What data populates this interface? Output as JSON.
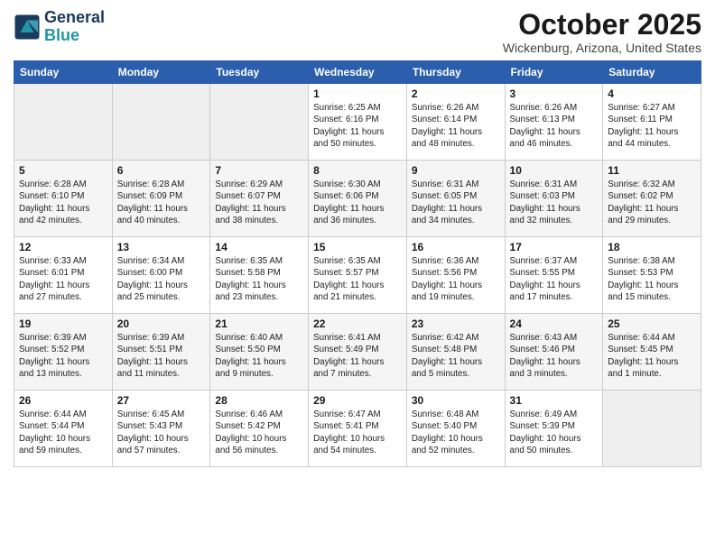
{
  "header": {
    "logo_line1": "General",
    "logo_line2": "Blue",
    "month": "October 2025",
    "location": "Wickenburg, Arizona, United States"
  },
  "days_of_week": [
    "Sunday",
    "Monday",
    "Tuesday",
    "Wednesday",
    "Thursday",
    "Friday",
    "Saturday"
  ],
  "weeks": [
    [
      {
        "day": "",
        "content": ""
      },
      {
        "day": "",
        "content": ""
      },
      {
        "day": "",
        "content": ""
      },
      {
        "day": "1",
        "content": "Sunrise: 6:25 AM\nSunset: 6:16 PM\nDaylight: 11 hours\nand 50 minutes."
      },
      {
        "day": "2",
        "content": "Sunrise: 6:26 AM\nSunset: 6:14 PM\nDaylight: 11 hours\nand 48 minutes."
      },
      {
        "day": "3",
        "content": "Sunrise: 6:26 AM\nSunset: 6:13 PM\nDaylight: 11 hours\nand 46 minutes."
      },
      {
        "day": "4",
        "content": "Sunrise: 6:27 AM\nSunset: 6:11 PM\nDaylight: 11 hours\nand 44 minutes."
      }
    ],
    [
      {
        "day": "5",
        "content": "Sunrise: 6:28 AM\nSunset: 6:10 PM\nDaylight: 11 hours\nand 42 minutes."
      },
      {
        "day": "6",
        "content": "Sunrise: 6:28 AM\nSunset: 6:09 PM\nDaylight: 11 hours\nand 40 minutes."
      },
      {
        "day": "7",
        "content": "Sunrise: 6:29 AM\nSunset: 6:07 PM\nDaylight: 11 hours\nand 38 minutes."
      },
      {
        "day": "8",
        "content": "Sunrise: 6:30 AM\nSunset: 6:06 PM\nDaylight: 11 hours\nand 36 minutes."
      },
      {
        "day": "9",
        "content": "Sunrise: 6:31 AM\nSunset: 6:05 PM\nDaylight: 11 hours\nand 34 minutes."
      },
      {
        "day": "10",
        "content": "Sunrise: 6:31 AM\nSunset: 6:03 PM\nDaylight: 11 hours\nand 32 minutes."
      },
      {
        "day": "11",
        "content": "Sunrise: 6:32 AM\nSunset: 6:02 PM\nDaylight: 11 hours\nand 29 minutes."
      }
    ],
    [
      {
        "day": "12",
        "content": "Sunrise: 6:33 AM\nSunset: 6:01 PM\nDaylight: 11 hours\nand 27 minutes."
      },
      {
        "day": "13",
        "content": "Sunrise: 6:34 AM\nSunset: 6:00 PM\nDaylight: 11 hours\nand 25 minutes."
      },
      {
        "day": "14",
        "content": "Sunrise: 6:35 AM\nSunset: 5:58 PM\nDaylight: 11 hours\nand 23 minutes."
      },
      {
        "day": "15",
        "content": "Sunrise: 6:35 AM\nSunset: 5:57 PM\nDaylight: 11 hours\nand 21 minutes."
      },
      {
        "day": "16",
        "content": "Sunrise: 6:36 AM\nSunset: 5:56 PM\nDaylight: 11 hours\nand 19 minutes."
      },
      {
        "day": "17",
        "content": "Sunrise: 6:37 AM\nSunset: 5:55 PM\nDaylight: 11 hours\nand 17 minutes."
      },
      {
        "day": "18",
        "content": "Sunrise: 6:38 AM\nSunset: 5:53 PM\nDaylight: 11 hours\nand 15 minutes."
      }
    ],
    [
      {
        "day": "19",
        "content": "Sunrise: 6:39 AM\nSunset: 5:52 PM\nDaylight: 11 hours\nand 13 minutes."
      },
      {
        "day": "20",
        "content": "Sunrise: 6:39 AM\nSunset: 5:51 PM\nDaylight: 11 hours\nand 11 minutes."
      },
      {
        "day": "21",
        "content": "Sunrise: 6:40 AM\nSunset: 5:50 PM\nDaylight: 11 hours\nand 9 minutes."
      },
      {
        "day": "22",
        "content": "Sunrise: 6:41 AM\nSunset: 5:49 PM\nDaylight: 11 hours\nand 7 minutes."
      },
      {
        "day": "23",
        "content": "Sunrise: 6:42 AM\nSunset: 5:48 PM\nDaylight: 11 hours\nand 5 minutes."
      },
      {
        "day": "24",
        "content": "Sunrise: 6:43 AM\nSunset: 5:46 PM\nDaylight: 11 hours\nand 3 minutes."
      },
      {
        "day": "25",
        "content": "Sunrise: 6:44 AM\nSunset: 5:45 PM\nDaylight: 11 hours\nand 1 minute."
      }
    ],
    [
      {
        "day": "26",
        "content": "Sunrise: 6:44 AM\nSunset: 5:44 PM\nDaylight: 10 hours\nand 59 minutes."
      },
      {
        "day": "27",
        "content": "Sunrise: 6:45 AM\nSunset: 5:43 PM\nDaylight: 10 hours\nand 57 minutes."
      },
      {
        "day": "28",
        "content": "Sunrise: 6:46 AM\nSunset: 5:42 PM\nDaylight: 10 hours\nand 56 minutes."
      },
      {
        "day": "29",
        "content": "Sunrise: 6:47 AM\nSunset: 5:41 PM\nDaylight: 10 hours\nand 54 minutes."
      },
      {
        "day": "30",
        "content": "Sunrise: 6:48 AM\nSunset: 5:40 PM\nDaylight: 10 hours\nand 52 minutes."
      },
      {
        "day": "31",
        "content": "Sunrise: 6:49 AM\nSunset: 5:39 PM\nDaylight: 10 hours\nand 50 minutes."
      },
      {
        "day": "",
        "content": ""
      }
    ]
  ]
}
